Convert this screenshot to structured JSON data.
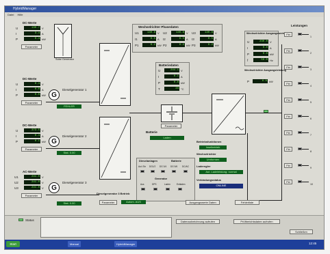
{
  "window": {
    "title": "HybridManager",
    "menu": [
      "Datei",
      "Hilfe"
    ]
  },
  "dc_blocks": [
    {
      "title": "DC-Werte",
      "rows": [
        {
          "k": "U",
          "v": "130.7",
          "u": "V"
        },
        {
          "k": "I",
          "v": "3.4",
          "u": "A"
        },
        {
          "k": "P",
          "v": "0.4",
          "u": "kW"
        }
      ],
      "button": "Parameter"
    },
    {
      "title": "DC-Werte",
      "rows": [
        {
          "k": "U",
          "v": "0.4",
          "u": "V"
        },
        {
          "k": "I",
          "v": "0.0",
          "u": "A"
        },
        {
          "k": "P",
          "v": "0.0",
          "u": "kW"
        }
      ],
      "button": "Parameter"
    },
    {
      "title": "DC-Werte",
      "rows": [
        {
          "k": "U",
          "v": "373.5",
          "u": "V"
        },
        {
          "k": "I",
          "v": "0.4",
          "u": "A"
        },
        {
          "k": "P",
          "v": "0.1",
          "u": "kW"
        }
      ],
      "button": "Parameter"
    },
    {
      "title": "AC-Werte",
      "rows": [
        {
          "k": "U1",
          "v": "241.0",
          "u": "V"
        },
        {
          "k": "U2",
          "v": "241.0",
          "u": "V"
        },
        {
          "k": "U3",
          "v": "241.0",
          "u": "V"
        }
      ],
      "button": "Parameter"
    }
  ],
  "solar_label": "Solar Generator",
  "generators": [
    {
      "title": "Dieselgenerator 1",
      "symbol": "G",
      "status": "FEHLER"
    },
    {
      "title": "Dieselgenerator 2",
      "symbol": "G",
      "status": "Stat. 0.00"
    },
    {
      "title": "Dieselgenerator 3",
      "symbol": "G",
      "status": "Stat. 0.00"
    }
  ],
  "wr_panel": {
    "title": "Wechselrichter Phasedaten",
    "rows": [
      {
        "cells": [
          {
            "k": "U1",
            "v": "140.8",
            "u": "V"
          },
          {
            "k": "U2",
            "v": "140.8",
            "u": "V"
          },
          {
            "k": "U3",
            "v": "140.8",
            "u": "V"
          }
        ]
      },
      {
        "cells": [
          {
            "k": "I1",
            "v": "0.5",
            "u": "A"
          },
          {
            "k": "I2",
            "v": "0.5",
            "u": "A"
          },
          {
            "k": "I3",
            "v": "0.5",
            "u": "A"
          }
        ]
      },
      {
        "cells": [
          {
            "k": "P1",
            "v": "0.2",
            "u": "kW"
          },
          {
            "k": "P2",
            "v": "0.2",
            "u": "kW"
          },
          {
            "k": "P3",
            "v": "0.2",
            "u": "kW"
          }
        ]
      }
    ]
  },
  "battery": {
    "title": "Batteriedaten",
    "rows": [
      {
        "k": "U",
        "v": "244.1",
        "u": "V"
      },
      {
        "k": "I",
        "v": "0.1",
        "u": "A"
      },
      {
        "k": "P",
        "v": "0.0",
        "u": "kW"
      },
      {
        "k": "T",
        "v": "23",
        "u": "°C"
      }
    ],
    "button": "Parameter",
    "label": "Batterie",
    "status": "Laden"
  },
  "wr_output": {
    "title": "Wechselrichter Ausgangswerte",
    "rows": [
      {
        "k": "U",
        "v": "230.0",
        "u": "V"
      },
      {
        "k": "I",
        "v": "0.0",
        "u": "A"
      },
      {
        "k": "P",
        "v": "0.0",
        "u": "kW"
      },
      {
        "k": "f",
        "v": "50.0",
        "u": "Hz"
      }
    ]
  },
  "wr_load": {
    "title": "Wechselrichter Ausgangsleistung",
    "k": "P",
    "v": "0.0",
    "u": "kW"
  },
  "loads_title": "Leistungen",
  "loads": [
    {
      "btn": "Fkt",
      "n": "1"
    },
    {
      "btn": "Fkt",
      "n": "2"
    },
    {
      "btn": "Fkt",
      "n": "3"
    },
    {
      "btn": "Fkt",
      "n": "4"
    },
    {
      "btn": "Fkt",
      "n": "5"
    },
    {
      "btn": "Fkt",
      "n": "6"
    },
    {
      "btn": "Fkt",
      "n": "7"
    },
    {
      "btn": "Fkt",
      "n": "8"
    },
    {
      "btn": "Fkt",
      "n": "9"
    },
    {
      "btn": "Fkt",
      "n": "10"
    }
  ],
  "control": {
    "title1": "Dieselanlagen",
    "title2": "Batterie",
    "top_labels": [
      "Aut. Ein",
      "DG1/2",
      "DG 3/4",
      "DG 5/6",
      "DC/AC"
    ],
    "group2": "Generator",
    "bottom_labels": [
      "Aus",
      "DPS",
      "Laden",
      "Entladen"
    ]
  },
  "betrieb": {
    "t1": "Betriebsfunktionen",
    "v1": "Inselbetrieb",
    "t2": "Wechselrichter",
    "v2": "Umformen",
    "t3": "Laderegler",
    "v3": "Aut. Ladeleistung: normal",
    "t4": "Verbindungsstatus",
    "v4": "ONLINE"
  },
  "diesel3_ctrl": {
    "title": "Dieselgenerator 3 Betrieb",
    "button": "Parameter",
    "status": "Autom. AUS"
  },
  "buttons": {
    "ausgang": "Ausgangswerte Daten",
    "fehler": "Fehlerliste"
  },
  "bottom": {
    "status_label": "Status",
    "b1": "Datenaufzeichnung aufrufen",
    "b2": "Prüfberichtsdaten aufrufen",
    "b3": "Schließen"
  },
  "taskbar": {
    "start": "Start",
    "tasks": [
      "Manual",
      "HybridManager"
    ],
    "clock": "12:45"
  },
  "colors": {
    "digit_bg": "#0b1f0b",
    "digit_fg": "#7cff5a",
    "status_green": "#0f5f1e",
    "status_blue": "#1a2e7a"
  }
}
